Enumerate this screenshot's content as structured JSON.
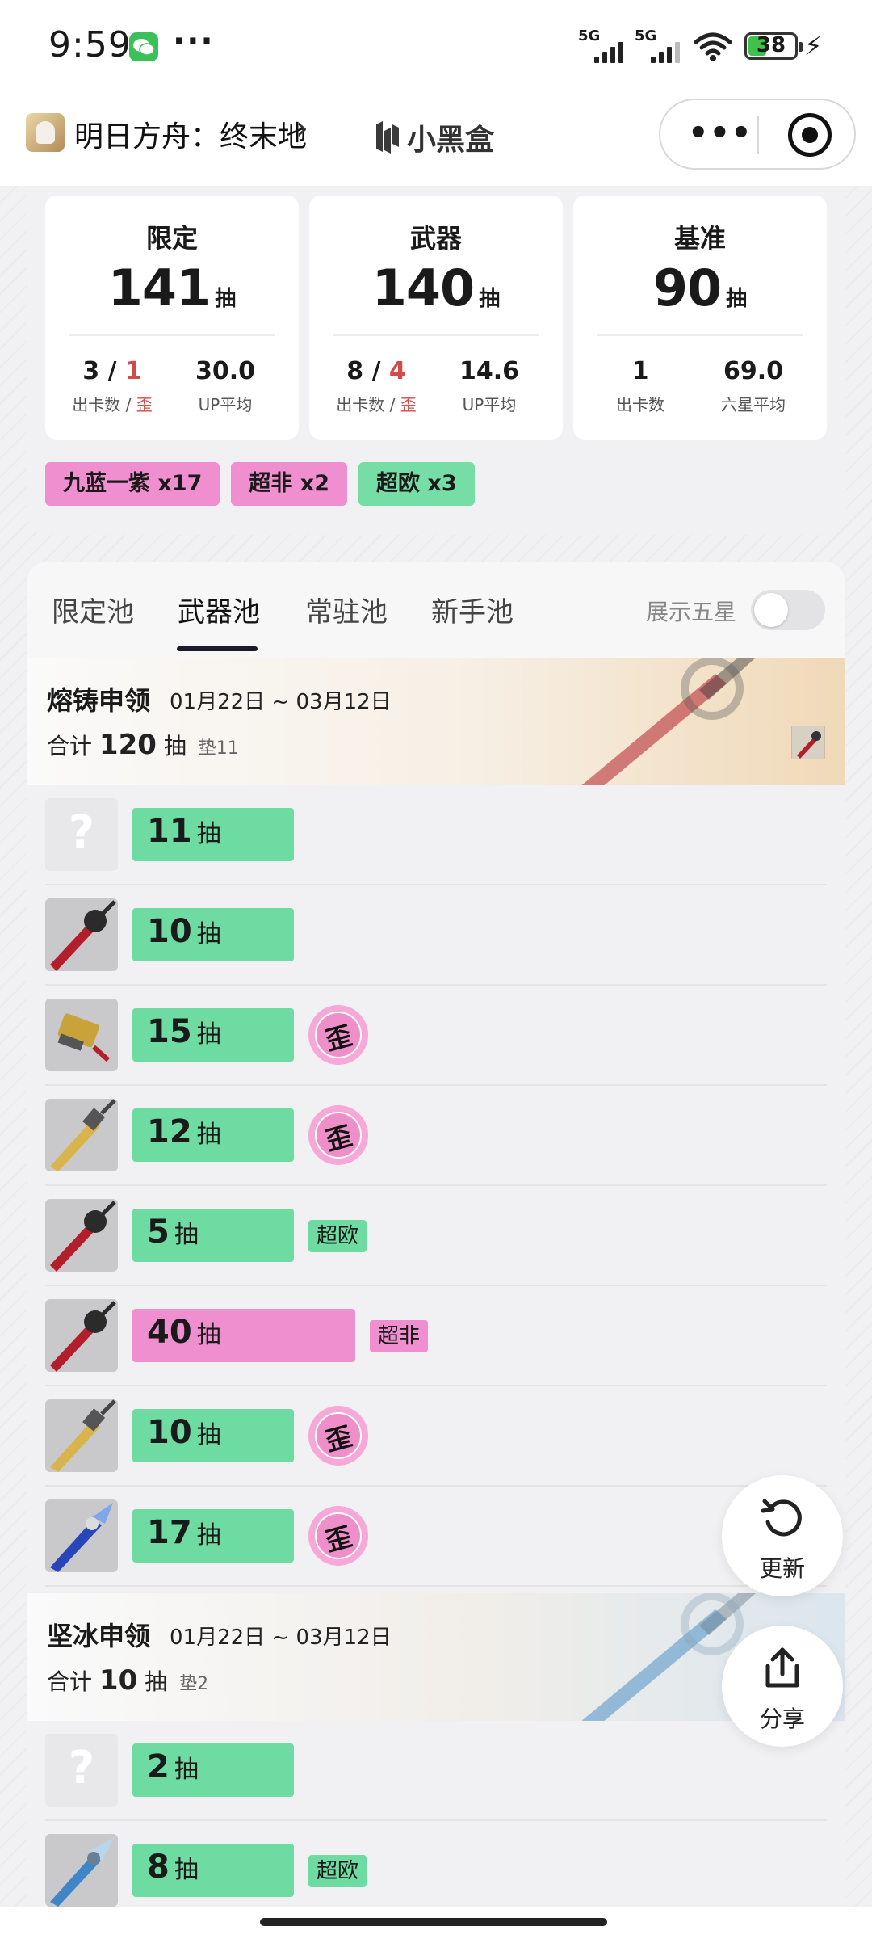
{
  "status_bar": {
    "time": "9:59",
    "network1": "5G",
    "network2": "5G",
    "battery": "38"
  },
  "mp_header": {
    "title": "明日方舟：终末地",
    "app_name": "小黑盒"
  },
  "stats": [
    {
      "title": "限定",
      "count": "141",
      "unit": "抽",
      "left_value": "3",
      "left_red": "1",
      "left_label": "出卡数 / ",
      "left_label_red": "歪",
      "right_value": "30.0",
      "right_label": "UP平均"
    },
    {
      "title": "武器",
      "count": "140",
      "unit": "抽",
      "left_value": "8",
      "left_red": "4",
      "left_label": "出卡数 / ",
      "left_label_red": "歪",
      "right_value": "14.6",
      "right_label": "UP平均"
    },
    {
      "title": "基准",
      "count": "90",
      "unit": "抽",
      "left_value": "1",
      "left_red": "",
      "left_label": "出卡数",
      "left_label_red": "",
      "right_value": "69.0",
      "right_label": "六星平均"
    }
  ],
  "tags": [
    {
      "text": "九蓝一紫 x17",
      "color": "#f08fcf"
    },
    {
      "text": "超非 x2",
      "color": "#f08fcf"
    },
    {
      "text": "超欧 x3",
      "color": "#77dda7"
    }
  ],
  "pool_tabs": [
    "限定池",
    "武器池",
    "常驻池",
    "新手池"
  ],
  "active_tab": "武器池",
  "show_five_star_label": "展示五星",
  "show_five_star": false,
  "banners": [
    {
      "name": "熔铸申领",
      "dates": "01月22日 ~ 03月12日",
      "total_prefix": "合计",
      "total": "120",
      "unit": "抽",
      "pad": "垫11",
      "rows": [
        {
          "pulls": "11",
          "unit": "抽",
          "icon": "question-icon",
          "badge": ""
        },
        {
          "pulls": "10",
          "unit": "抽",
          "icon": "red-sword-icon",
          "badge": ""
        },
        {
          "pulls": "15",
          "unit": "抽",
          "icon": "gold-cannon-icon",
          "badge": "歪"
        },
        {
          "pulls": "12",
          "unit": "抽",
          "icon": "gold-sword-icon",
          "badge": "歪"
        },
        {
          "pulls": "5",
          "unit": "抽",
          "icon": "red-sword-icon",
          "badge": "",
          "chip": "超欧",
          "chip_color": "#6ddba2"
        },
        {
          "pulls": "40",
          "unit": "抽",
          "icon": "red-sword-icon",
          "badge": "",
          "chip": "超非",
          "chip_color": "#f08fcf"
        },
        {
          "pulls": "10",
          "unit": "抽",
          "icon": "gold-sword-icon",
          "badge": "歪"
        },
        {
          "pulls": "17",
          "unit": "抽",
          "icon": "blue-sword-icon",
          "badge": "歪"
        }
      ]
    },
    {
      "name": "坚冰申领",
      "dates": "01月22日 ~ 03月12日",
      "total_prefix": "合计",
      "total": "10",
      "unit": "抽",
      "pad": "垫2",
      "rows": [
        {
          "pulls": "2",
          "unit": "抽",
          "icon": "question-icon",
          "badge": ""
        },
        {
          "pulls": "8",
          "unit": "抽",
          "icon": "ice-sword-icon",
          "badge": "",
          "chip": "超欧",
          "chip_color": "#6ddba2"
        }
      ]
    }
  ],
  "fabs": {
    "refresh": "更新",
    "share": "分享"
  }
}
